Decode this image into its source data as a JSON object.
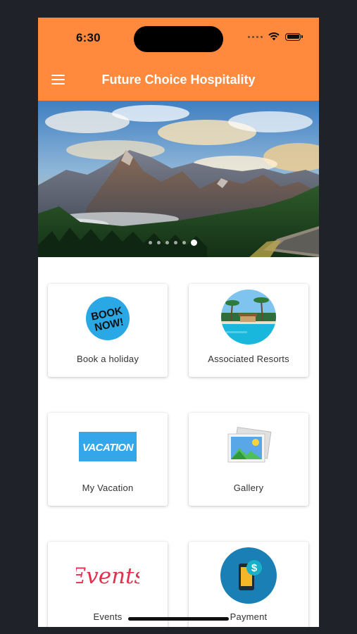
{
  "status_bar": {
    "time": "6:30"
  },
  "app_bar": {
    "title": "Future Choice Hospitality"
  },
  "carousel": {
    "total_slides": 6,
    "active_index": 5
  },
  "tiles": [
    {
      "label": "Book a holiday",
      "icon_name": "book-now-icon",
      "icon_text_1": "BOOK",
      "icon_text_2": "NOW!"
    },
    {
      "label": "Associated Resorts",
      "icon_name": "resort-pool-icon"
    },
    {
      "label": "My Vacation",
      "icon_name": "vacation-icon",
      "icon_text": "VACATION"
    },
    {
      "label": "Gallery",
      "icon_name": "gallery-icon"
    },
    {
      "label": "Events",
      "icon_name": "events-icon",
      "icon_text": "Events"
    },
    {
      "label": "Payment",
      "icon_name": "payment-icon",
      "icon_text": "$"
    }
  ],
  "colors": {
    "accent": "#FF8A3D",
    "background": "#1f2329",
    "payment_circle": "#1A7FB5",
    "events_text": "#E0314F"
  }
}
